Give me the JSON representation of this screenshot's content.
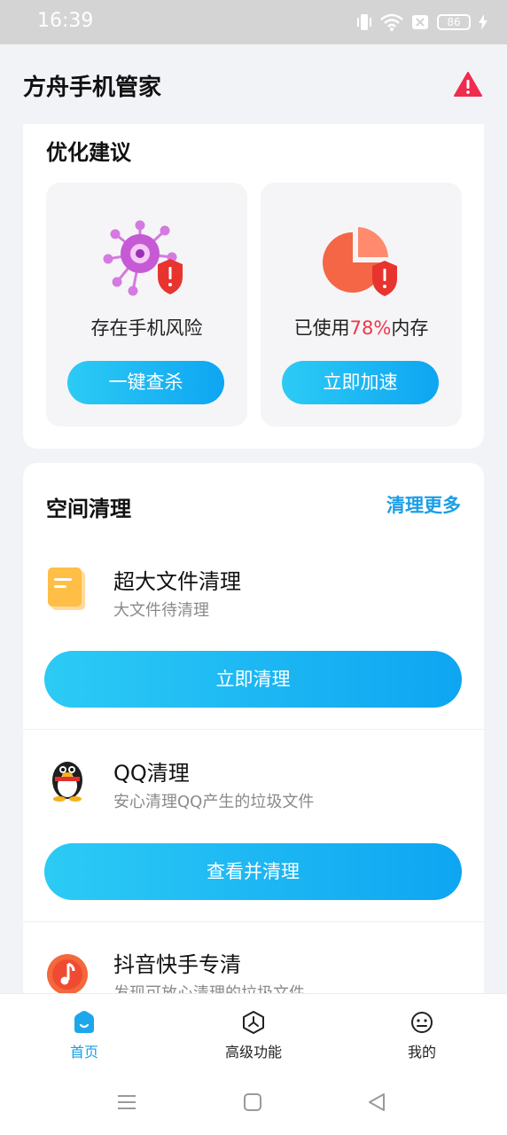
{
  "status_bar": {
    "time": "16:39",
    "battery": "86"
  },
  "header": {
    "title": "方舟手机管家"
  },
  "optimize": {
    "title": "优化建议",
    "risk": {
      "label": "存在手机风险",
      "button": "一键查杀"
    },
    "memory": {
      "label_prefix": "已使用",
      "percent": "78%",
      "label_suffix": "内存",
      "button": "立即加速"
    }
  },
  "space": {
    "title": "空间清理",
    "more": "清理更多",
    "items": [
      {
        "title": "超大文件清理",
        "subtitle": "大文件待清理",
        "button": "立即清理"
      },
      {
        "title": "QQ清理",
        "subtitle": "安心清理QQ产生的垃圾文件",
        "button": "查看并清理"
      },
      {
        "title": "抖音快手专清",
        "subtitle": "发现可放心清理的垃圾文件"
      }
    ]
  },
  "nav": {
    "home": "首页",
    "advanced": "高级功能",
    "mine": "我的"
  },
  "colors": {
    "accent": "#1a9ee8",
    "danger": "#f0364a",
    "button_start": "#2ccbf5",
    "button_end": "#0ea5f2"
  }
}
